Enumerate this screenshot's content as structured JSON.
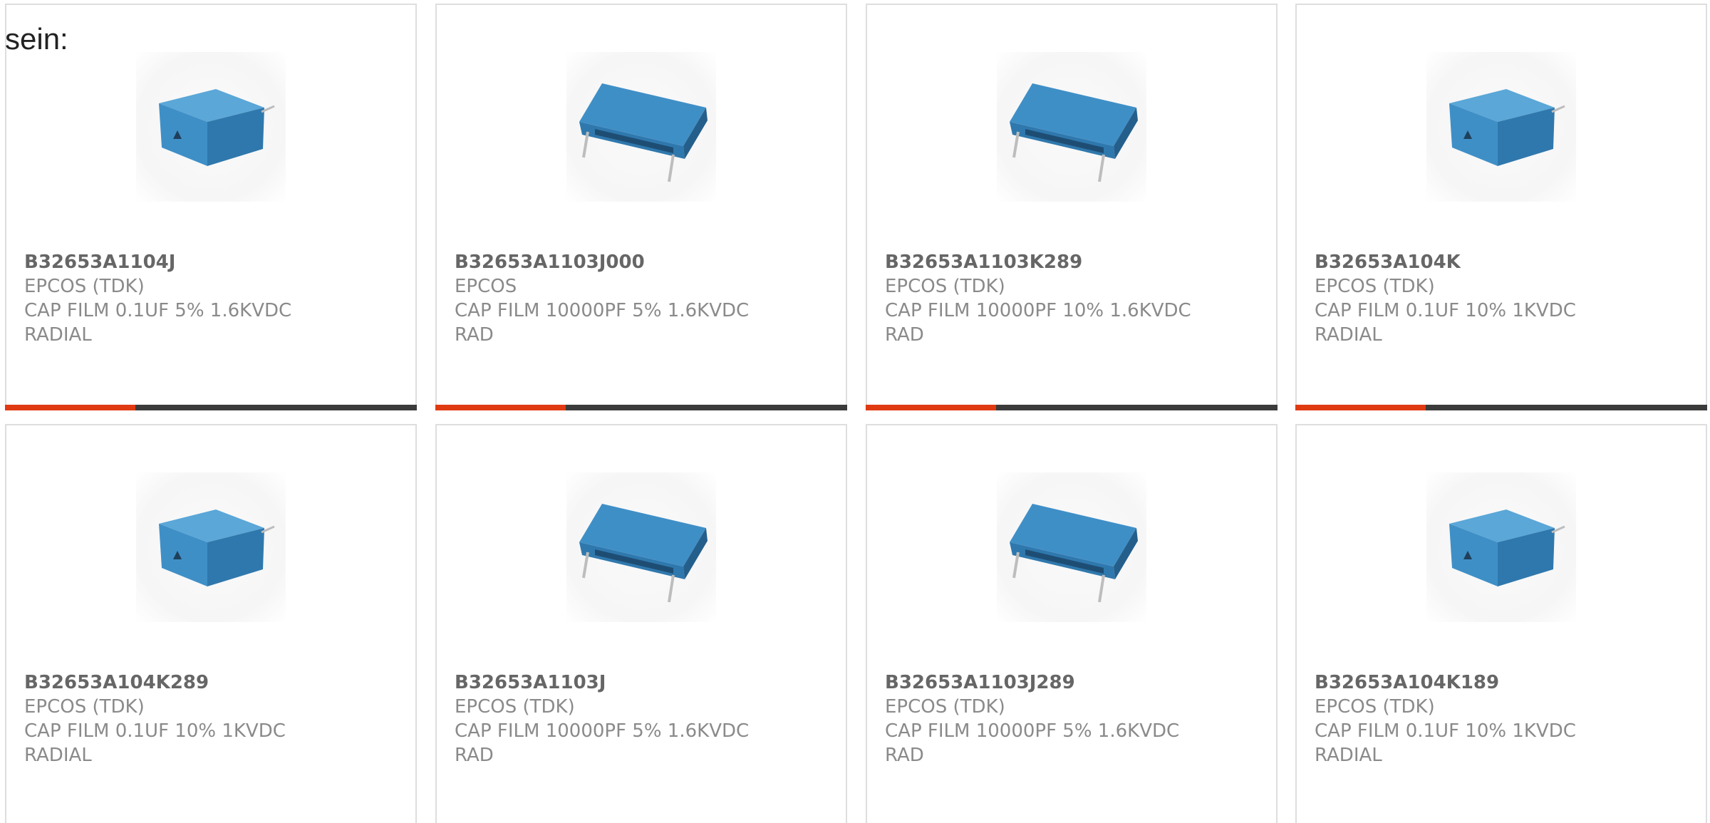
{
  "intro_text": "sein:",
  "colors": {
    "accent": "#e03a12",
    "bar": "#3b3b3b",
    "capacitor_blue": "#3f8fc7"
  },
  "products": [
    {
      "part": "B32653A1104J",
      "maker": "EPCOS (TDK)",
      "desc1": "CAP FILM 0.1UF 5% 1.6KVDC",
      "desc2": "RADIAL",
      "image_icon": "box-capacitor-icon"
    },
    {
      "part": "B32653A1103J000",
      "maker": "EPCOS",
      "desc1": "CAP FILM 10000PF 5% 1.6KVDC",
      "desc2": "RAD",
      "image_icon": "long-capacitor-icon"
    },
    {
      "part": "B32653A1103K289",
      "maker": "EPCOS (TDK)",
      "desc1": "CAP FILM 10000PF 10% 1.6KVDC",
      "desc2": "RAD",
      "image_icon": "long-capacitor-icon"
    },
    {
      "part": "B32653A104K",
      "maker": "EPCOS (TDK)",
      "desc1": "CAP FILM 0.1UF 10% 1KVDC",
      "desc2": "RADIAL",
      "image_icon": "box-capacitor-icon"
    },
    {
      "part": "B32653A104K289",
      "maker": "EPCOS (TDK)",
      "desc1": "CAP FILM 0.1UF 10% 1KVDC",
      "desc2": "RADIAL",
      "image_icon": "box-capacitor-icon"
    },
    {
      "part": "B32653A1103J",
      "maker": "EPCOS (TDK)",
      "desc1": "CAP FILM 10000PF 5% 1.6KVDC",
      "desc2": "RAD",
      "image_icon": "long-capacitor-icon"
    },
    {
      "part": "B32653A1103J289",
      "maker": "EPCOS (TDK)",
      "desc1": "CAP FILM 10000PF 5% 1.6KVDC",
      "desc2": "RAD",
      "image_icon": "long-capacitor-icon"
    },
    {
      "part": "B32653A104K189",
      "maker": "EPCOS (TDK)",
      "desc1": "CAP FILM 0.1UF 10% 1KVDC",
      "desc2": "RADIAL",
      "image_icon": "box-capacitor-icon"
    }
  ]
}
